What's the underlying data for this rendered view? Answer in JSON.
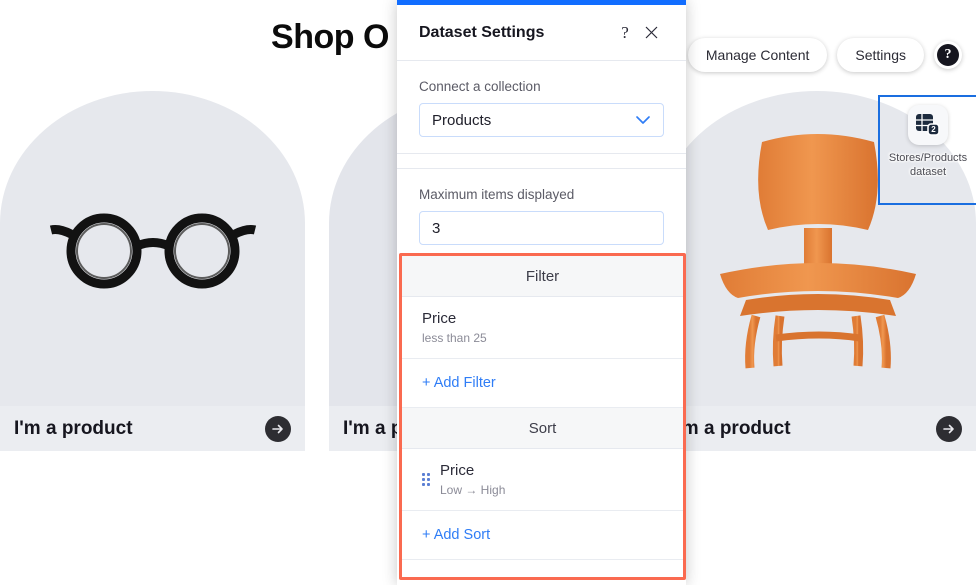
{
  "site": {
    "page_title": "Shop O",
    "editor_buttons": [
      {
        "label": "Manage Content",
        "name": "manage-content-button"
      },
      {
        "label": "Settings",
        "name": "settings-button"
      }
    ],
    "help_button_glyph": "?",
    "dataset_badge": {
      "label": "Stores/Products dataset",
      "icon": "dataset-icon"
    },
    "products": [
      {
        "name": "I'm a product",
        "image": "eyeglasses-photo",
        "arrow": "→"
      },
      {
        "name": "I'm a product",
        "image": "product-photo",
        "arrow": "→"
      },
      {
        "name": "I'm a product",
        "image": "wooden-chair-photo",
        "arrow": "→"
      }
    ]
  },
  "panel": {
    "title": "Dataset Settings",
    "help_glyph": "?",
    "close_glyph": "×",
    "collection": {
      "label": "Connect a collection",
      "value": "Products"
    },
    "max_items": {
      "label": "Maximum items displayed",
      "value": "3"
    },
    "filter": {
      "section_title": "Filter",
      "rules": [
        {
          "field": "Price",
          "condition": "less than 25"
        }
      ],
      "add_label": "+ Add Filter"
    },
    "sort": {
      "section_title": "Sort",
      "rules": [
        {
          "field": "Price",
          "condition": "Low → High"
        }
      ],
      "add_label": "+ Add Sort"
    }
  },
  "colors": {
    "accent_blue": "#116dff",
    "link_blue": "#2f7df6",
    "highlight_red": "#fa6a50",
    "selection_blue": "#1a6ee0"
  }
}
